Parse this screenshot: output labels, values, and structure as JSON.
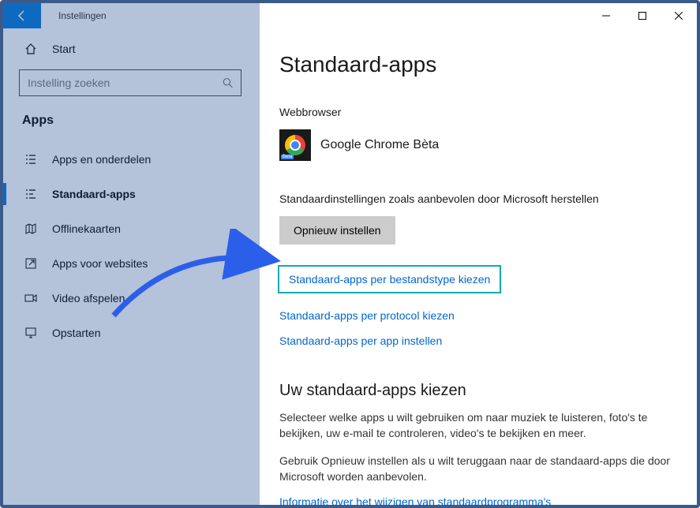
{
  "window": {
    "title": "Instellingen"
  },
  "sidebar": {
    "home_label": "Start",
    "search_placeholder": "Instelling zoeken",
    "heading": "Apps",
    "items": [
      {
        "label": "Apps en onderdelen"
      },
      {
        "label": "Standaard-apps"
      },
      {
        "label": "Offlinekaarten"
      },
      {
        "label": "Apps voor websites"
      },
      {
        "label": "Video afspelen"
      },
      {
        "label": "Opstarten"
      }
    ]
  },
  "main": {
    "heading": "Standaard-apps",
    "browser_section": "Webbrowser",
    "browser_app": "Google Chrome Bèta",
    "reset_text": "Standaardinstellingen zoals aanbevolen door Microsoft herstellen",
    "reset_btn": "Opnieuw instellen",
    "link_filetype": "Standaard-apps per bestandstype kiezen",
    "link_protocol": "Standaard-apps per protocol kiezen",
    "link_perapp": "Standaard-apps per app instellen",
    "subheading": "Uw standaard-apps kiezen",
    "para1": "Selecteer welke apps u wilt gebruiken om naar muziek te luisteren, foto's te bekijken, uw e-mail te controleren, video's te bekijken en meer.",
    "para2": "Gebruik Opnieuw instellen als u wilt teruggaan naar de standaard-apps die door Microsoft worden aanbevolen.",
    "infolink": "Informatie over het wijzigen van standaardprogramma's"
  }
}
